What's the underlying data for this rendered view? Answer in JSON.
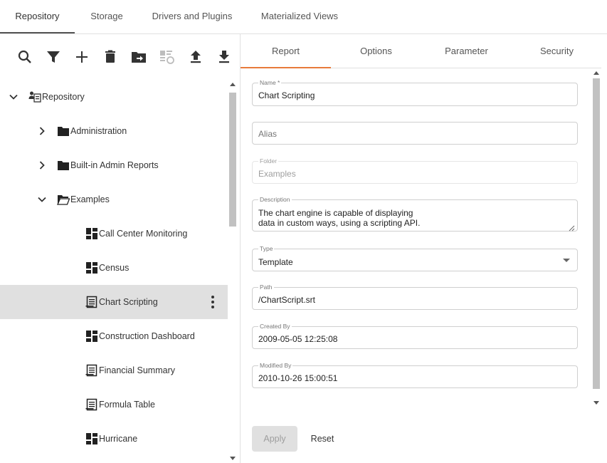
{
  "top_tabs": [
    "Repository",
    "Storage",
    "Drivers and Plugins",
    "Materialized Views"
  ],
  "toolbar": {
    "icons": [
      "search-icon",
      "filter-icon",
      "add-icon",
      "delete-icon",
      "move-folder-icon",
      "sync-icon",
      "upload-icon",
      "download-icon"
    ]
  },
  "tree": {
    "items": [
      {
        "label": "Repository",
        "icon": "repository-users-icon",
        "expanded": true
      },
      {
        "label": "Administration",
        "icon": "folder-icon",
        "expanded": false
      },
      {
        "label": "Built-in Admin Reports",
        "icon": "folder-icon",
        "expanded": false
      },
      {
        "label": "Examples",
        "icon": "folder-open-icon",
        "expanded": true
      },
      {
        "label": "Call Center Monitoring",
        "icon": "dashboard-icon"
      },
      {
        "label": "Census",
        "icon": "dashboard-icon"
      },
      {
        "label": "Chart Scripting",
        "icon": "report-icon",
        "selected": true
      },
      {
        "label": "Construction Dashboard",
        "icon": "dashboard-icon"
      },
      {
        "label": "Financial Summary",
        "icon": "report-icon"
      },
      {
        "label": "Formula Table",
        "icon": "report-icon"
      },
      {
        "label": "Hurricane",
        "icon": "dashboard-icon"
      }
    ]
  },
  "detail_tabs": [
    "Report",
    "Options",
    "Parameter",
    "Security"
  ],
  "form": {
    "name": {
      "label": "Name *",
      "value": "Chart Scripting"
    },
    "alias": {
      "placeholder": "Alias"
    },
    "folder": {
      "label": "Folder",
      "value": "Examples"
    },
    "description": {
      "label": "Description",
      "line1": "The chart engine is capable of displaying",
      "line2": "data in custom ways, using a scripting API."
    },
    "type": {
      "label": "Type",
      "value": "Template"
    },
    "path": {
      "label": "Path",
      "value": "/ChartScript.srt"
    },
    "created_by": {
      "label": "Created By",
      "value": "2009-05-05 12:25:08"
    },
    "modified_by": {
      "label": "Modified By",
      "value": "2010-10-26 15:00:51"
    }
  },
  "actions": {
    "apply": "Apply",
    "reset": "Reset"
  },
  "colors": {
    "accent": "#e87a3b",
    "selected_row": "#e0e0e0"
  }
}
